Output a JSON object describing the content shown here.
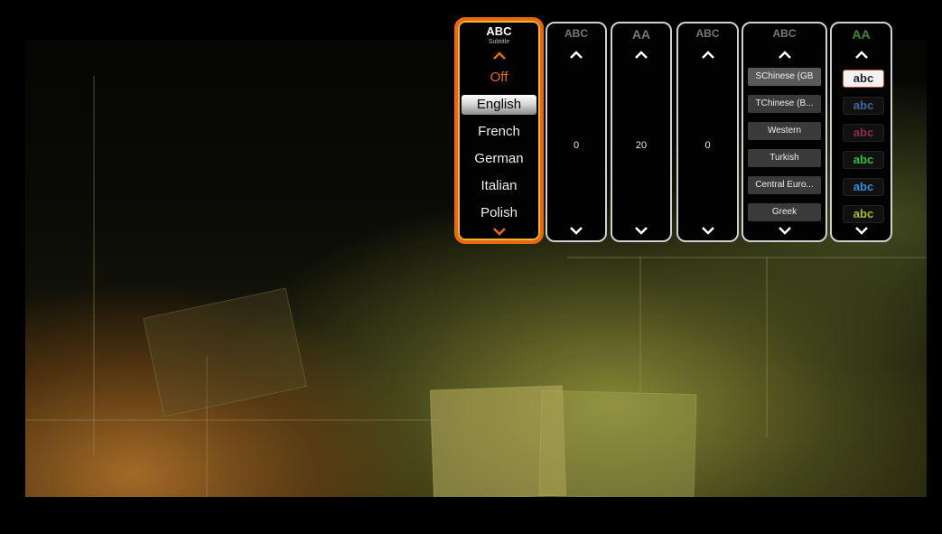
{
  "subtitle_panel": {
    "header_icon_text": "ABC",
    "header_label": "Subtitle",
    "items": [
      "Off",
      "English",
      "French",
      "German",
      "Italian",
      "Polish"
    ],
    "selected": "English",
    "highlight_color": "#e86a10"
  },
  "position_panel": {
    "header_icon_text": "ABC",
    "value": "0"
  },
  "size_panel": {
    "header_icon_text": "AA",
    "value": "20"
  },
  "offset_panel": {
    "header_icon_text": "ABC",
    "value": "0"
  },
  "encoding_panel": {
    "header_icon_text": "ABC",
    "items": [
      "SChinese (GB",
      "TChinese (B...",
      "Western",
      "Turkish",
      "Central Euro...",
      "Greek"
    ]
  },
  "color_panel": {
    "header_icon_text": "AA",
    "swatches": [
      {
        "label": "abc",
        "text_color": "#202020",
        "bg": "#f2f2f2",
        "border": "#c05030"
      },
      {
        "label": "abc",
        "text_color": "#3c6a9a",
        "bg": "#111111",
        "border": "#222222"
      },
      {
        "label": "abc",
        "text_color": "#8a2a4a",
        "bg": "#111111",
        "border": "#222222"
      },
      {
        "label": "abc",
        "text_color": "#2fbf3a",
        "bg": "#111111",
        "border": "#222222"
      },
      {
        "label": "abc",
        "text_color": "#2a8fd8",
        "bg": "#111111",
        "border": "#222222"
      },
      {
        "label": "abc",
        "text_color": "#a8c020",
        "bg": "#111111",
        "border": "#222222"
      }
    ]
  },
  "icons": {
    "up": "chevron-up-icon",
    "down": "chevron-down-icon"
  }
}
